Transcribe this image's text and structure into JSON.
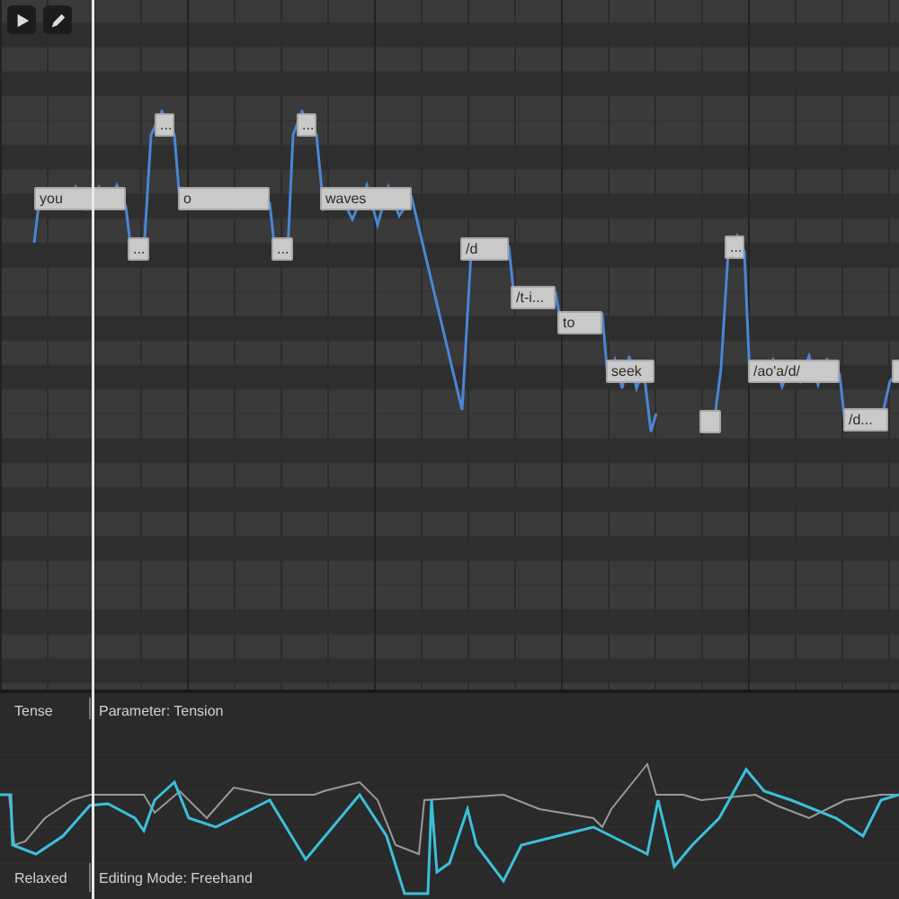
{
  "toolbar": [
    {
      "kind": "play"
    },
    {
      "kind": "pencil"
    }
  ],
  "notes": [
    {
      "kind": "note",
      "lyric": "you"
    },
    {
      "kind": "note",
      "lyric": "..."
    },
    {
      "kind": "note",
      "lyric": "..."
    },
    {
      "kind": "note",
      "lyric": "o"
    },
    {
      "kind": "note",
      "lyric": "..."
    },
    {
      "kind": "note",
      "lyric": "..."
    },
    {
      "kind": "note",
      "lyric": "waves"
    },
    {
      "kind": "note",
      "lyric": "/d"
    },
    {
      "kind": "note",
      "lyric": "/t-i..."
    },
    {
      "kind": "note",
      "lyric": "to"
    },
    {
      "kind": "note",
      "lyric": "seek"
    },
    {
      "kind": "note"
    },
    {
      "kind": "note",
      "lyric": "..."
    },
    {
      "kind": "note",
      "lyric": "/ao'a/d/"
    },
    {
      "kind": "note",
      "lyric": "/d..."
    },
    {
      "kind": "note"
    }
  ],
  "parameter_panel": {
    "top_label": "Tense",
    "bottom_label": "Relaxed",
    "parameter": "Parameter: Tension",
    "mode": "Editing Mode: Freehand"
  }
}
